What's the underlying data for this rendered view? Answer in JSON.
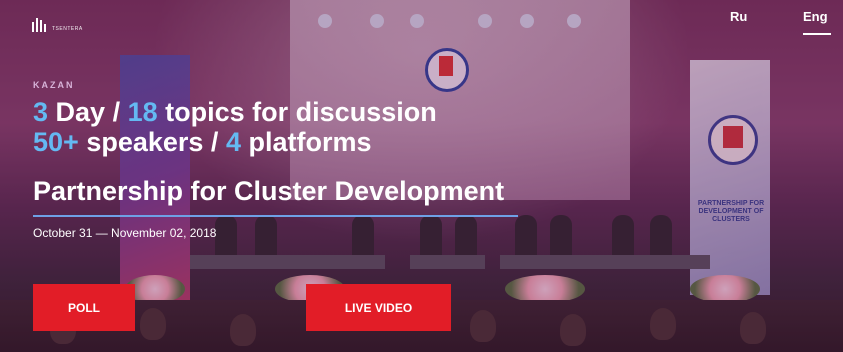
{
  "header": {
    "logo_text": "TSENTERA",
    "languages": [
      {
        "label": "Ru",
        "active": false
      },
      {
        "label": "Eng",
        "active": true
      }
    ]
  },
  "hero": {
    "city": "KAZAN",
    "stats": {
      "days_num": "3",
      "days_label": "Day /",
      "topics_num": "18",
      "topics_label": "topics for discussion",
      "speakers_num": "50+",
      "speakers_label": "speakers /",
      "platforms_num": "4",
      "platforms_label": "platforms"
    },
    "title": "Partnership for Cluster Development",
    "dates": "October 31 — November 02, 2018",
    "buttons": {
      "poll": "POLL",
      "live_video": "LIVE VIDEO"
    }
  },
  "background": {
    "banner_text": "PARTNERSHIP FOR DEVELOPMENT OF CLUSTERS"
  },
  "colors": {
    "accent_red": "#e21d27",
    "number_blue": "#64b9f2",
    "underline_blue": "#6ea1e6"
  }
}
